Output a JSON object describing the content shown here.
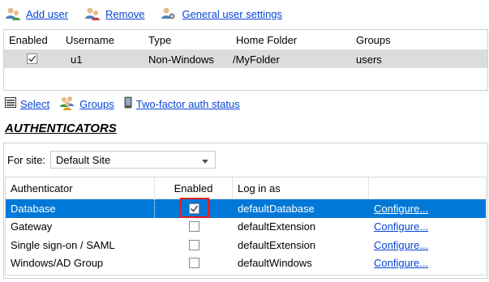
{
  "toolbar": {
    "add_user": "Add user",
    "remove": "Remove",
    "general_settings": "General user settings"
  },
  "users_table": {
    "headers": [
      "Enabled",
      "Username",
      "Type",
      "Home Folder",
      "Groups"
    ],
    "rows": [
      {
        "enabled": true,
        "username": "u1",
        "type": "Non-Windows",
        "home_folder": "/MyFolder",
        "groups": "users"
      }
    ]
  },
  "toolbar2": {
    "select": "Select",
    "groups": "Groups",
    "two_factor": "Two-factor auth status"
  },
  "authenticators": {
    "title": "AUTHENTICATORS",
    "site_label": "For site:",
    "site_value": "Default Site",
    "headers": [
      "Authenticator",
      "Enabled",
      "Log in as",
      ""
    ],
    "rows": [
      {
        "name": "Database",
        "enabled": true,
        "login_as": "defaultDatabase",
        "configure": "Configure..."
      },
      {
        "name": "Gateway",
        "enabled": false,
        "login_as": "defaultExtension",
        "configure": "Configure..."
      },
      {
        "name": "Single sign-on / SAML",
        "enabled": false,
        "login_as": "defaultExtension",
        "configure": "Configure..."
      },
      {
        "name": "Windows/AD Group",
        "enabled": false,
        "login_as": "defaultWindows",
        "configure": "Configure..."
      }
    ]
  }
}
